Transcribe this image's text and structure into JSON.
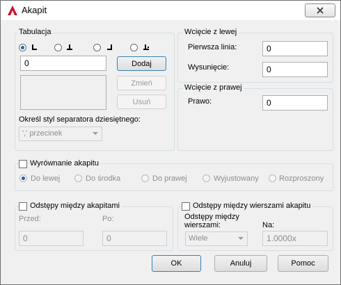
{
  "window": {
    "title": "Akapit"
  },
  "tabulation": {
    "label": "Tabulacja",
    "value": "0",
    "add_button": "Dodaj",
    "modify_button": "Zmień",
    "delete_button": "Usuń",
    "separator_label": "Określ styl separatora dziesiętnego:",
    "separator_value": "',' przecinek",
    "tab_types": [
      {
        "icon": "left-tab-icon",
        "checked": true
      },
      {
        "icon": "center-tab-icon",
        "checked": false
      },
      {
        "icon": "right-tab-icon",
        "checked": false
      },
      {
        "icon": "decimal-tab-icon",
        "checked": false
      }
    ]
  },
  "left_indent": {
    "label": "Wcięcie z lewej",
    "first_line_label": "Pierwsza linia:",
    "first_line_value": "0",
    "hanging_label": "Wysunięcie:",
    "hanging_value": "0"
  },
  "right_indent": {
    "label": "Wcięcie z prawej",
    "right_label": "Prawo:",
    "right_value": "0"
  },
  "alignment": {
    "label": "Wyrównanie akapitu",
    "checked": false,
    "options": [
      "Do lewej",
      "Do środka",
      "Do prawej",
      "Wyjustowany",
      "Rozproszony"
    ],
    "selected_index": 0
  },
  "paragraph_spacing": {
    "label": "Odstępy między akapitami",
    "checked": false,
    "before_label": "Przed:",
    "before_value": "0",
    "after_label": "Po:",
    "after_value": "0"
  },
  "line_spacing": {
    "label": "Odstępy między wierszami akapitu",
    "checked": false,
    "spacing_label_1": "Odstępy między",
    "spacing_label_2": "wierszami:",
    "spacing_value": "Wiele",
    "at_label": "Na:",
    "at_value": "1.0000x"
  },
  "buttons": {
    "ok": "OK",
    "cancel": "Anuluj",
    "help": "Pomoc"
  }
}
